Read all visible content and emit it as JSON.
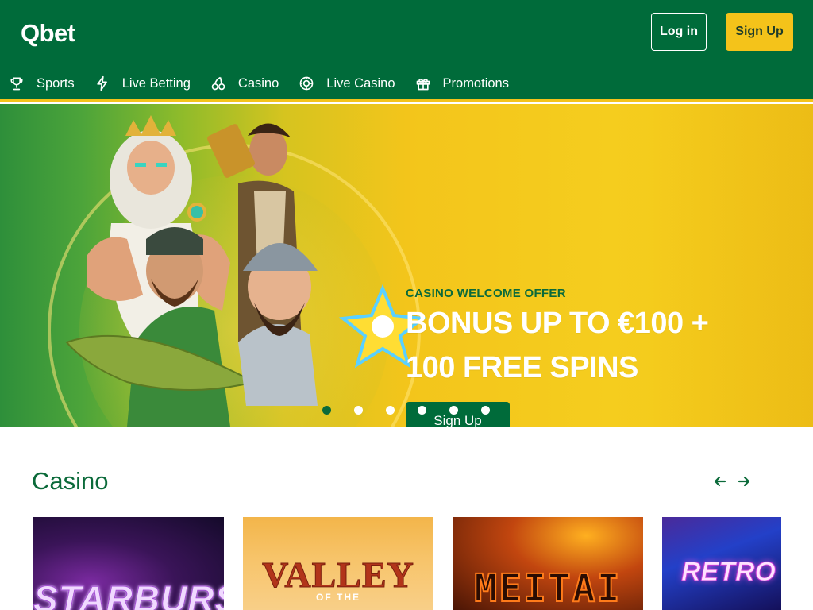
{
  "header": {
    "logo_text": "Qbet",
    "login_label": "Log in",
    "signup_label": "Sign Up"
  },
  "nav": {
    "items": [
      {
        "label": "Sports",
        "icon": "trophy-icon"
      },
      {
        "label": "Live Betting",
        "icon": "lightning-icon"
      },
      {
        "label": "Casino",
        "icon": "cherries-icon"
      },
      {
        "label": "Live Casino",
        "icon": "poker-chip-icon"
      },
      {
        "label": "Promotions",
        "icon": "gift-icon"
      }
    ]
  },
  "hero": {
    "kicker": "CASINO WELCOME OFFER",
    "headline_line1": "BONUS UP TO €100 +",
    "headline_line2": "100 FREE SPINS",
    "cta_label": "Sign Up",
    "slide_count": 6,
    "active_slide": 1
  },
  "casino": {
    "title": "Casino",
    "games": [
      {
        "name": "STARBURST"
      },
      {
        "name": "VALLEY",
        "subtitle": "OF THE"
      },
      {
        "name": "MEITAI"
      },
      {
        "name": "RETRO"
      }
    ]
  },
  "colors": {
    "brand_green": "#006b3a",
    "brand_yellow": "#f4c31a",
    "text_green": "#0b6a3a"
  }
}
